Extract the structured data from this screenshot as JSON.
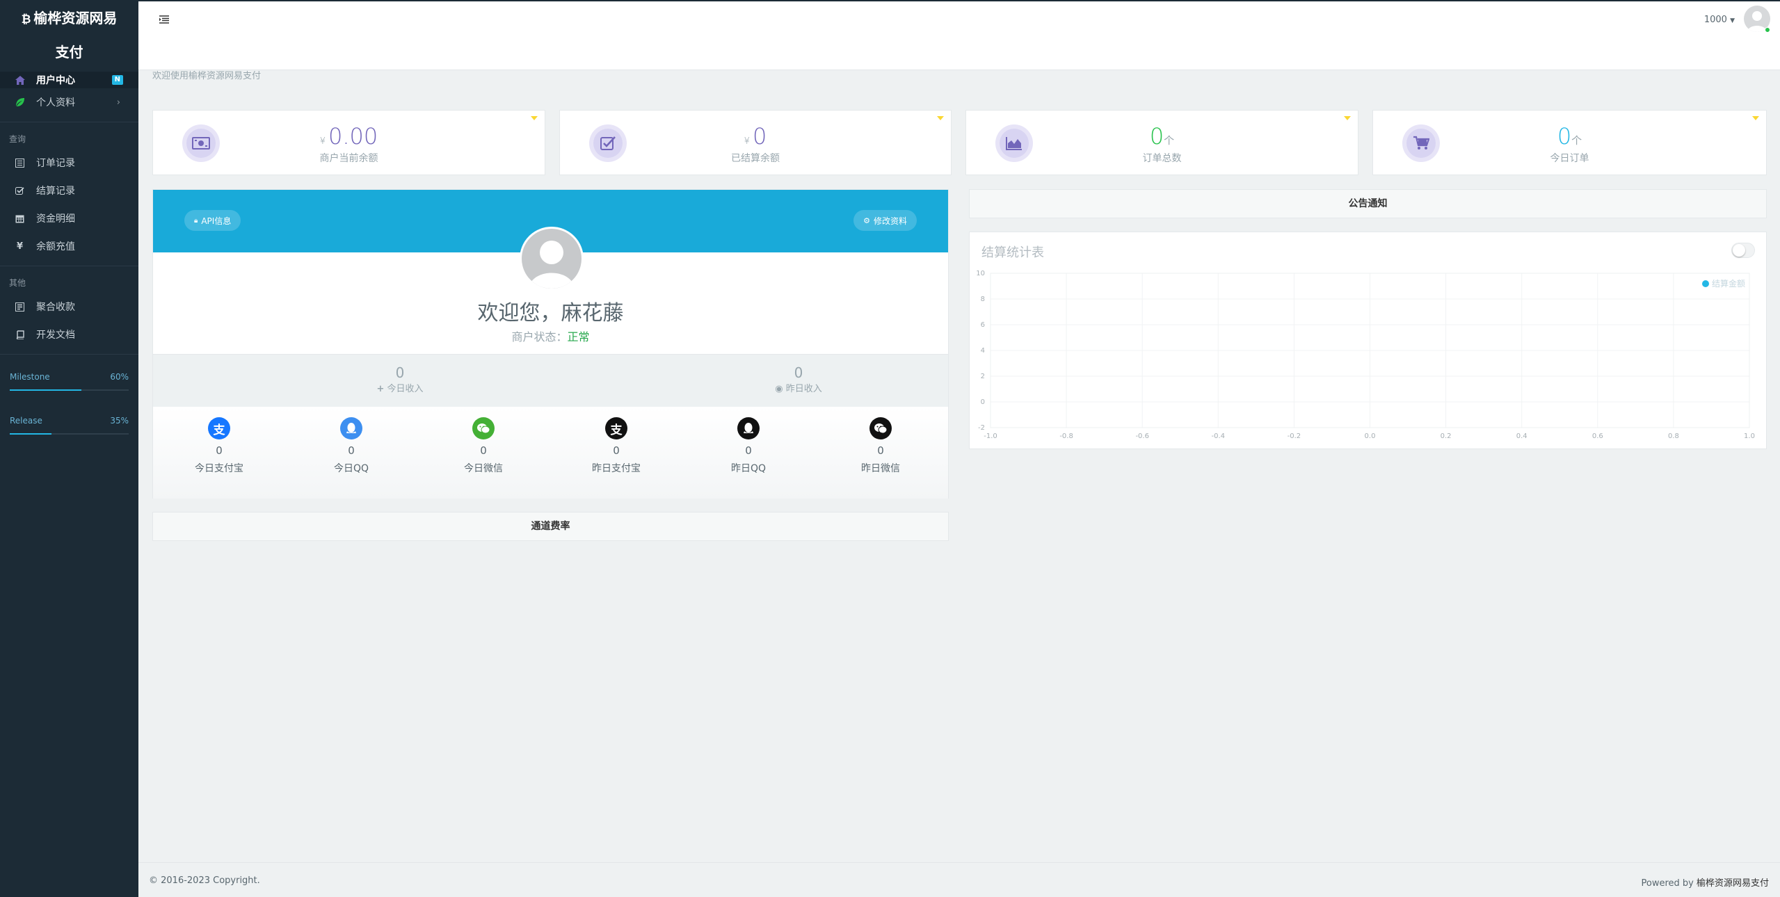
{
  "brand": {
    "line1": "榆桦资源网易",
    "line2": "支付"
  },
  "sidebar": {
    "active_item": {
      "label": "用户中心",
      "badge": "N"
    },
    "profile_item": {
      "label": "个人资料"
    },
    "section_query": "查询",
    "query_items": [
      {
        "label": "订单记录",
        "icon": "list-icon"
      },
      {
        "label": "结算记录",
        "icon": "check-square-icon"
      },
      {
        "label": "资金明细",
        "icon": "calendar-icon"
      },
      {
        "label": "余额充值",
        "icon": "yen-icon"
      }
    ],
    "section_other": "其他",
    "other_items": [
      {
        "label": "聚合收款",
        "icon": "qrcode-icon"
      },
      {
        "label": "开发文档",
        "icon": "book-icon"
      }
    ],
    "progress": [
      {
        "label": "Milestone",
        "percent_text": "60%",
        "value": 0.6
      },
      {
        "label": "Release",
        "percent_text": "35%",
        "value": 0.35
      }
    ]
  },
  "header": {
    "user": "1000"
  },
  "welcome": "欢迎使用榆桦资源网易支付",
  "stats": [
    {
      "currency": "¥",
      "value": "0.00",
      "unit": "",
      "label": "商户当前余额",
      "icon": "money-icon"
    },
    {
      "currency": "¥",
      "value": "0",
      "unit": "",
      "label": "已结算余额",
      "icon": "check-icon"
    },
    {
      "currency": "",
      "value": "0",
      "unit": "个",
      "label": "订单总数",
      "icon": "area-chart-icon"
    },
    {
      "currency": "",
      "value": "0",
      "unit": "个",
      "label": "今日订单",
      "icon": "cart-icon"
    }
  ],
  "profile": {
    "api_button": "API信息",
    "edit_button": "修改资料",
    "greeting": "欢迎您，麻花藤",
    "status_label": "商户状态：",
    "status_value": "正常",
    "today_income": {
      "value": "0",
      "label": "今日收入"
    },
    "yesterday_income": {
      "value": "0",
      "label": "昨日收入"
    },
    "channels": [
      {
        "value": "0",
        "label": "今日支付宝",
        "icon": "alipay-icon",
        "color": "#1677ff"
      },
      {
        "value": "0",
        "label": "今日QQ",
        "icon": "qq-icon",
        "color": "#3d8ff0"
      },
      {
        "value": "0",
        "label": "今日微信",
        "icon": "wechat-icon",
        "color": "#44b035"
      },
      {
        "value": "0",
        "label": "昨日支付宝",
        "icon": "alipay-icon",
        "color": "#111111"
      },
      {
        "value": "0",
        "label": "昨日QQ",
        "icon": "qq-icon",
        "color": "#111111"
      },
      {
        "value": "0",
        "label": "昨日微信",
        "icon": "wechat-icon",
        "color": "#111111"
      }
    ]
  },
  "rates_title": "通道费率",
  "notice_title": "公告通知",
  "chart_data": {
    "type": "line",
    "title": "结算统计表",
    "series": [
      {
        "name": "结算金额",
        "values": []
      }
    ],
    "xlim": [
      -1.0,
      1.0
    ],
    "ylim": [
      -2,
      10
    ],
    "x_ticks": [
      "-1.0",
      "-0.8",
      "-0.6",
      "-0.4",
      "-0.2",
      "0.0",
      "0.2",
      "0.4",
      "0.6",
      "0.8",
      "1.0"
    ],
    "y_ticks": [
      "10",
      "8",
      "6",
      "4",
      "2",
      "0",
      "-2"
    ],
    "legend": "top-right",
    "grid": true,
    "series_color": "#23b7e5"
  },
  "footer": {
    "copyright": "© 2016-2023 Copyright.",
    "powered_prefix": "Powered by ",
    "powered_name": "榆桦资源网易支付"
  }
}
